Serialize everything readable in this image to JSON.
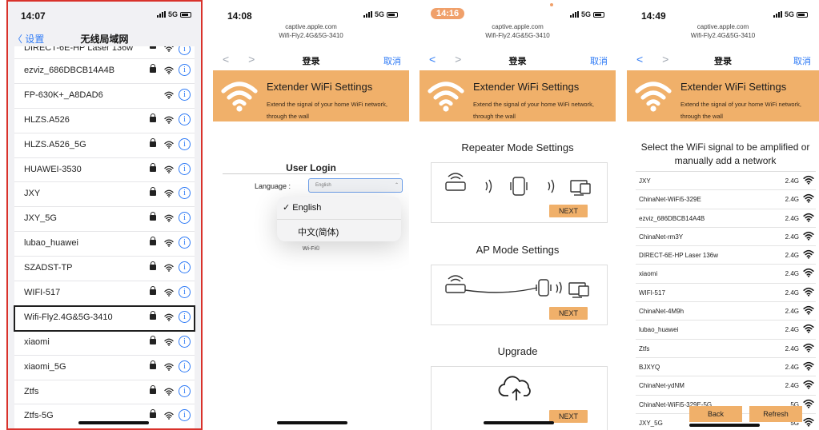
{
  "colors": {
    "accent": "#f0b06a",
    "ios_blue": "#2f7bf6",
    "highlight_frame": "#d9322b"
  },
  "panel1": {
    "status": {
      "time": "14:07",
      "network": "5G"
    },
    "nav": {
      "back": "〈 设置",
      "title": "无线局域网"
    },
    "networks": [
      {
        "name": "DIRECT-6E-HP Laser 136w",
        "locked": true
      },
      {
        "name": "ezviz_686DBCB14A4B",
        "locked": true
      },
      {
        "name": "FP-630K+_A8DAD6",
        "locked": false
      },
      {
        "name": "HLZS.A526",
        "locked": true
      },
      {
        "name": "HLZS.A526_5G",
        "locked": true
      },
      {
        "name": "HUAWEI-3530",
        "locked": true
      },
      {
        "name": "JXY",
        "locked": true
      },
      {
        "name": "JXY_5G",
        "locked": true
      },
      {
        "name": "lubao_huawei",
        "locked": true
      },
      {
        "name": "SZADST-TP",
        "locked": true
      },
      {
        "name": "WIFI-517",
        "locked": true
      },
      {
        "name": "Wifi-Fly2.4G&5G-3410",
        "locked": true,
        "highlighted": true
      },
      {
        "name": "xiaomi",
        "locked": true
      },
      {
        "name": "xiaomi_5G",
        "locked": true
      },
      {
        "name": "Ztfs",
        "locked": true
      },
      {
        "name": "Ztfs-5G",
        "locked": true
      }
    ]
  },
  "captive": {
    "domain": "captive.apple.com",
    "ssid": "Wifi-Fly2.4G&5G-3410",
    "nav_title": "登录",
    "cancel": "取消",
    "banner_title": "Extender WiFi Settings",
    "banner_subtitle": "Extend the signal of your home WiFi network, through the wall"
  },
  "panel2": {
    "status": {
      "time": "14:08",
      "network": "5G"
    },
    "login_title": "User Login",
    "language_label": "Language :",
    "language_value": "English",
    "options": [
      "✓ English",
      "中文(简体)"
    ],
    "footer": "Wi-Fi©"
  },
  "panel3": {
    "status": {
      "time": "14:16",
      "network": "5G"
    },
    "repeater_title": "Repeater Mode Settings",
    "ap_title": "AP Mode Settings",
    "upgrade_title": "Upgrade",
    "next": "NEXT"
  },
  "panel4": {
    "status": {
      "time": "14:49",
      "network": "5G"
    },
    "heading": "Select the WiFi signal to be amplified or manually add a network",
    "networks": [
      {
        "name": "JXY",
        "band": "2.4G"
      },
      {
        "name": "ChinaNet-WiFi5-329E",
        "band": "2.4G"
      },
      {
        "name": "ezviz_686DBCB14A4B",
        "band": "2.4G"
      },
      {
        "name": "ChinaNet-rm3Y",
        "band": "2.4G"
      },
      {
        "name": "DIRECT-6E-HP Laser 136w",
        "band": "2.4G"
      },
      {
        "name": "xiaomi",
        "band": "2.4G"
      },
      {
        "name": "WIFI-517",
        "band": "2.4G"
      },
      {
        "name": "ChinaNet-4M9h",
        "band": "2.4G"
      },
      {
        "name": "lubao_huawei",
        "band": "2.4G"
      },
      {
        "name": "Ztfs",
        "band": "2.4G"
      },
      {
        "name": "BJXYQ",
        "band": "2.4G"
      },
      {
        "name": "ChinaNet-ydNM",
        "band": "2.4G"
      },
      {
        "name": "ChinaNet-WiFi5-329E-5G",
        "band": "5G"
      },
      {
        "name": "JXY_5G",
        "band": "5G"
      }
    ],
    "back": "Back",
    "refresh": "Refresh"
  }
}
